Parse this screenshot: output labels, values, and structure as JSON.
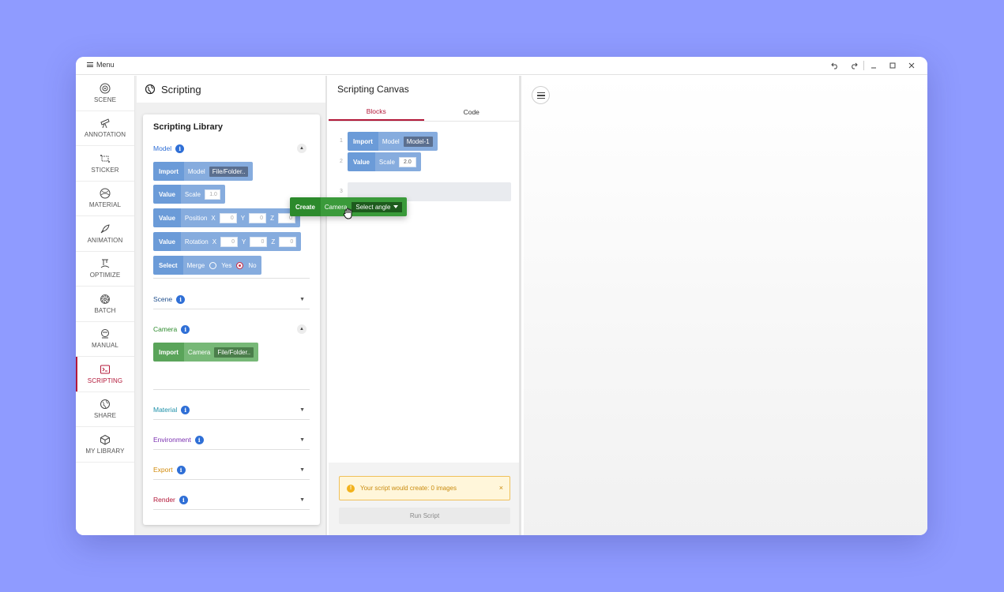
{
  "titlebar": {
    "menu_label": "Menu",
    "controls": [
      "undo-icon",
      "redo-icon",
      "minimize-icon",
      "maximize-icon",
      "close-icon"
    ]
  },
  "nav": {
    "items": [
      {
        "label": "SCENE",
        "icon": "scene-icon"
      },
      {
        "label": "ANNOTATION",
        "icon": "telescope-icon"
      },
      {
        "label": "STICKER",
        "icon": "sticker-icon"
      },
      {
        "label": "MATERIAL",
        "icon": "material-icon"
      },
      {
        "label": "ANIMATION",
        "icon": "rocket-icon"
      },
      {
        "label": "OPTIMIZE",
        "icon": "optimize-icon"
      },
      {
        "label": "BATCH",
        "icon": "gear-icon"
      },
      {
        "label": "MANUAL",
        "icon": "manual-icon"
      },
      {
        "label": "SCRIPTING",
        "icon": "terminal-icon",
        "active": true
      },
      {
        "label": "SHARE",
        "icon": "globe-icon"
      },
      {
        "label": "MY LIBRARY",
        "icon": "cube-icon"
      }
    ],
    "active_color": "#b3193a"
  },
  "library": {
    "header": "Scripting",
    "title": "Scripting Library",
    "sections": {
      "model": {
        "label": "Model",
        "color": "#2f6fd6",
        "blocks": {
          "import": {
            "key": "Import",
            "field": "Model",
            "value": "File/Folder.."
          },
          "scale": {
            "key": "Value",
            "field": "Scale",
            "value": "1.0"
          },
          "position": {
            "key": "Value",
            "field": "Position",
            "x": "0",
            "y": "0",
            "z": "0"
          },
          "rotation": {
            "key": "Value",
            "field": "Rotation",
            "x": "0",
            "y": "0",
            "z": "0"
          },
          "select": {
            "key": "Select",
            "field": "Merge",
            "yes": "Yes",
            "no": "No"
          }
        }
      },
      "scene": {
        "label": "Scene",
        "color": "#1f4e8c"
      },
      "camera": {
        "label": "Camera",
        "color": "#2e8b2e",
        "blocks": {
          "import": {
            "key": "Import",
            "field": "Camera",
            "value": "File/Folder.."
          }
        }
      },
      "material": {
        "label": "Material",
        "color": "#1b8fa8"
      },
      "environment": {
        "label": "Environment",
        "color": "#7a2fb0"
      },
      "export": {
        "label": "Export",
        "color": "#d18a0a"
      },
      "render": {
        "label": "Render",
        "color": "#b3193a"
      }
    },
    "axis": {
      "x": "X",
      "y": "Y",
      "z": "Z"
    }
  },
  "canvas": {
    "title": "Scripting Canvas",
    "tabs": {
      "blocks": "Blocks",
      "code": "Code"
    },
    "lines": [
      "1",
      "2",
      "3"
    ],
    "line1": {
      "key": "Import",
      "field": "Model",
      "value": "Model-1"
    },
    "line2": {
      "key": "Value",
      "field": "Scale",
      "value": "2.0"
    },
    "dragging": {
      "key": "Create",
      "field": "Camera",
      "value": "Select angle"
    },
    "warning": "Your script would create: 0 images",
    "warning_close": "×",
    "run_label": "Run Script"
  }
}
